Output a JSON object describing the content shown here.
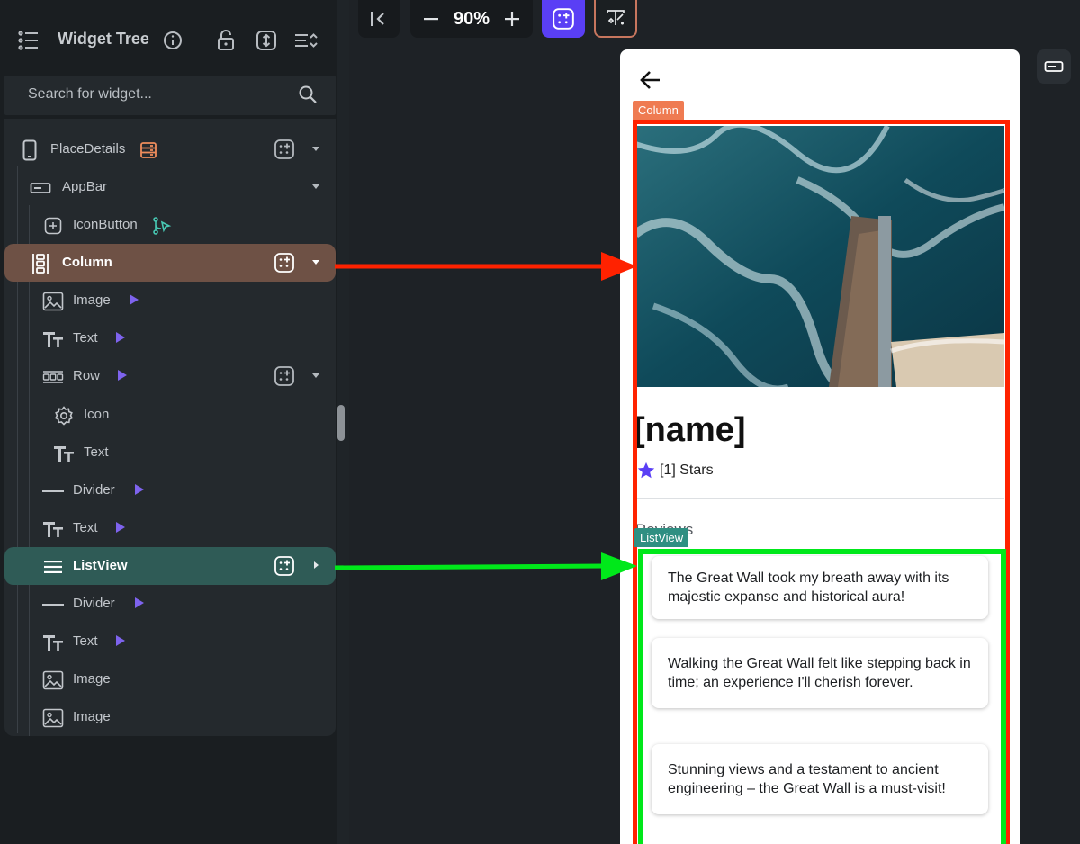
{
  "panel": {
    "title": "Widget Tree",
    "search_placeholder": "Search for widget..."
  },
  "tree": [
    {
      "label": "PlaceDetails",
      "icon": "phone-icon"
    },
    {
      "label": "AppBar",
      "icon": "appbar-icon"
    },
    {
      "label": "IconButton",
      "icon": "add-box-icon"
    },
    {
      "label": "Column",
      "icon": "column-icon"
    },
    {
      "label": "Image",
      "icon": "image-icon"
    },
    {
      "label": "Text",
      "icon": "text-icon"
    },
    {
      "label": "Row",
      "icon": "row-icon"
    },
    {
      "label": "Icon",
      "icon": "gear-icon"
    },
    {
      "label": "Text",
      "icon": "text-icon"
    },
    {
      "label": "Divider",
      "icon": "divider-icon"
    },
    {
      "label": "Text",
      "icon": "text-icon"
    },
    {
      "label": "ListView",
      "icon": "list-icon"
    },
    {
      "label": "Divider",
      "icon": "divider-icon"
    },
    {
      "label": "Text",
      "icon": "text-icon"
    },
    {
      "label": "Image",
      "icon": "image-icon"
    },
    {
      "label": "Image",
      "icon": "image-icon"
    }
  ],
  "toolbar": {
    "zoom": "90%"
  },
  "preview": {
    "column_tag": "Column",
    "listview_tag": "ListView",
    "name": "[name]",
    "stars": "[1] Stars",
    "reviews_title": "Reviews",
    "reviews": [
      "The Great Wall took my breath away with its majestic expanse and historical aura!",
      "Walking the Great Wall felt like stepping back in time; an experience I'll cherish forever.",
      "Stunning views and a testament to ancient engineering – the Great Wall is a must-visit!"
    ]
  },
  "colors": {
    "column_highlight": "#ff2200",
    "listview_highlight": "#00e81a",
    "accent": "#5a3ff5"
  }
}
